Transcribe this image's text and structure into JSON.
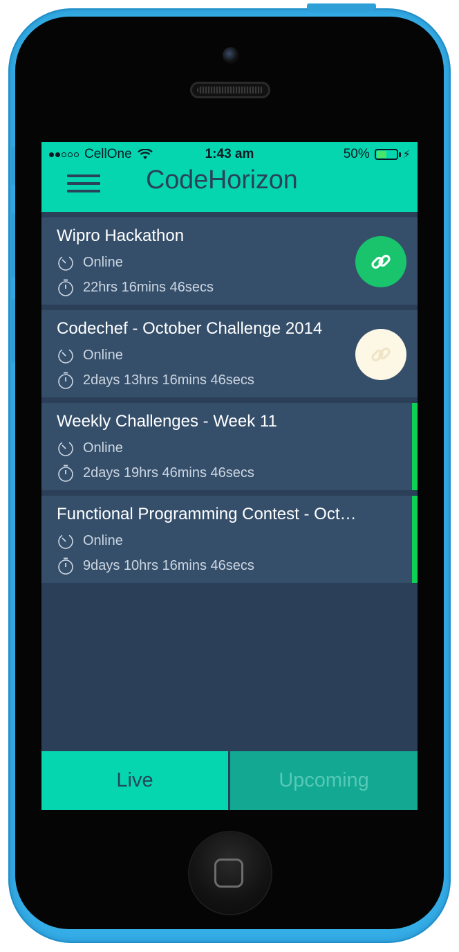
{
  "status_bar": {
    "carrier": "CellOne",
    "time": "1:43 am",
    "battery_percent": "50%",
    "battery_level": 0.5
  },
  "header": {
    "title": "CodeHorizon",
    "menu_icon": "hamburger-menu-icon"
  },
  "contests": [
    {
      "title": "Wipro Hackathon",
      "location": "Online",
      "time_left": "22hrs 16mins 46secs",
      "link_button": {
        "icon": "link-icon",
        "bg": "#19c46c",
        "icon_color": "#ffffff"
      }
    },
    {
      "title": "Codechef - October Challenge 2014",
      "location": "Online",
      "time_left": "2days 13hrs 16mins 46secs",
      "link_button": {
        "icon": "link-icon",
        "bg": "#fdf7e6",
        "icon_color": "#f3e9cf"
      }
    },
    {
      "title": "Weekly Challenges - Week 11",
      "location": "Online",
      "time_left": "2days 19hrs 46mins 46secs",
      "indicator_color": "#0fd056"
    },
    {
      "title": "Functional Programming Contest - Oct…",
      "location": "Online",
      "time_left": "9days 10hrs 16mins 46secs",
      "indicator_color": "#0fd056"
    }
  ],
  "tabs": {
    "live": "Live",
    "upcoming": "Upcoming",
    "selected": "Live"
  },
  "colors": {
    "accent": "#06d6b0",
    "screen_bg": "#2b3f58",
    "card_bg": "#354f6b",
    "phone_body": "#35aee8"
  }
}
